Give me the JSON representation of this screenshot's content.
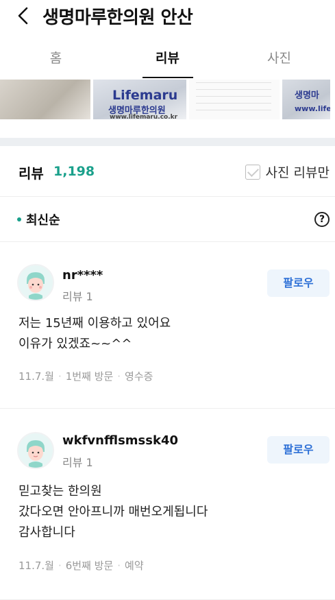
{
  "header": {
    "title": "생명마루한의원 안산",
    "back_icon": "chevron-left-icon"
  },
  "tabs": [
    {
      "label": "홈",
      "active": false
    },
    {
      "label": "리뷰",
      "active": true
    },
    {
      "label": "사진",
      "active": false
    }
  ],
  "photos": {
    "p2_text1": "Lifemaru",
    "p2_text2": "생명마루한의원",
    "p2_text3": "www.lifemaru.co.kr",
    "p4_text1": "생명마",
    "p4_text2": "www.life"
  },
  "reviews_header": {
    "title": "리뷰",
    "count": "1,198",
    "photo_only_label": "사진 리뷰만"
  },
  "sort": {
    "label": "최신순"
  },
  "reviews": [
    {
      "username": "nr****",
      "review_count": "리뷰 1",
      "follow_label": "팔로우",
      "line1": "저는 15년째 이용하고 있어요",
      "line2": "이유가 있겠죠~~^^",
      "date": "11.7.월",
      "visit": "1번째 방문",
      "method": "영수증"
    },
    {
      "username": "wkfvnfflsmssk40",
      "review_count": "리뷰 1",
      "follow_label": "팔로우",
      "line1": "믿고찾는 한의원",
      "line2": "갔다오면 안아프니까 매번오게됩니다",
      "line3": "감사합니다",
      "date": "11.7.월",
      "visit": "6번째 방문",
      "method": "예약"
    }
  ],
  "colors": {
    "accent": "#1aa08b",
    "follow_text": "#2c6fd6",
    "follow_bg": "#eef5fc"
  }
}
